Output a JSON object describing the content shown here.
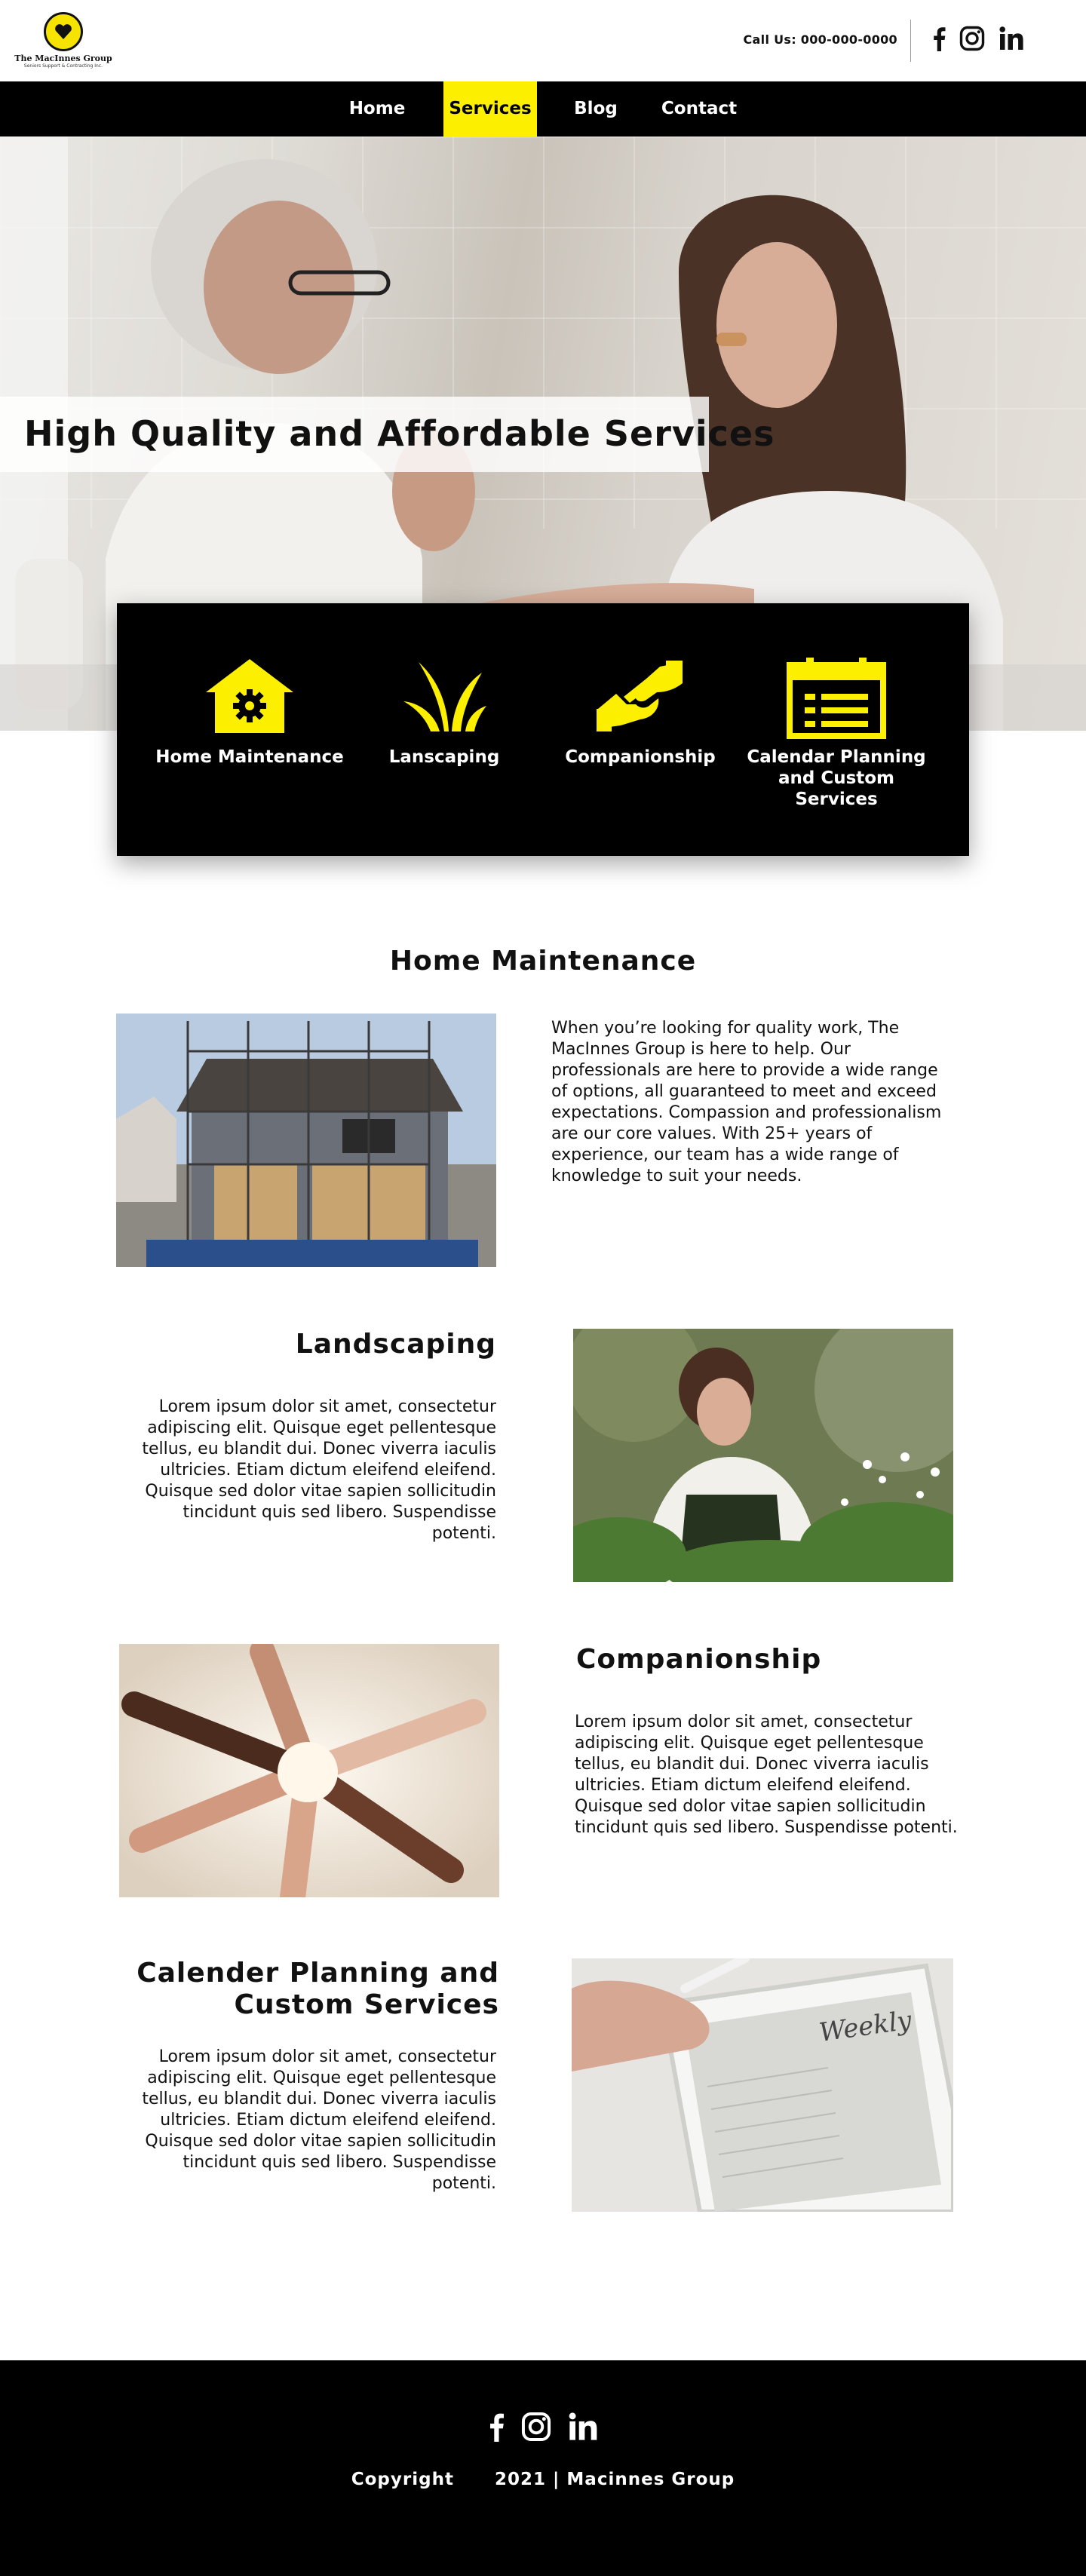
{
  "header": {
    "logo_name": "The MacInnes Group",
    "logo_sub": "Seniors Support & Contracting Inc.",
    "call_label": "Call Us: 000-000-0000",
    "social_icons": [
      "facebook-icon",
      "instagram-icon",
      "linkedin-icon"
    ]
  },
  "nav": {
    "items": [
      {
        "label": "Home",
        "active": false
      },
      {
        "label": "Services",
        "active": true
      },
      {
        "label": "Blog",
        "active": false
      },
      {
        "label": "Contact",
        "active": false
      }
    ]
  },
  "hero": {
    "title": "High Quality and Affordable Services"
  },
  "services_summary": {
    "items": [
      {
        "label": "Home Maintenance",
        "icon": "house-gear-icon"
      },
      {
        "label": "Lanscaping",
        "icon": "plant-icon"
      },
      {
        "label": "Companionship",
        "icon": "handshake-icon"
      },
      {
        "label": "Calendar Planning and Custom Services",
        "icon": "calendar-icon"
      }
    ]
  },
  "sections": {
    "home_maintenance": {
      "title": "Home Maintenance",
      "text": "When you’re looking for quality work, The MacInnes Group is here to help.  Our professionals are here to provide a wide range of options, all guaranteed to meet and exceed expectations. Compassion and professionalism are our core values. With 25+ years of experience, our team has a wide range of knowledge to suit your needs."
    },
    "landscaping": {
      "title": "Landscaping",
      "text": "Lorem ipsum dolor sit amet, consectetur adipiscing elit. Quisque eget pellentesque tellus, eu blandit dui. Donec viverra iaculis ultricies. Etiam dictum eleifend eleifend. Quisque sed dolor vitae sapien sollicitudin tincidunt quis sed libero. Suspendisse potenti."
    },
    "companionship": {
      "title": "Companionship",
      "text": "Lorem ipsum dolor sit amet, consectetur adipiscing elit. Quisque eget pellentesque tellus, eu blandit dui. Donec viverra iaculis ultricies. Etiam dictum eleifend eleifend. Quisque sed dolor vitae sapien sollicitudin tincidunt quis sed libero. Suspendisse potenti."
    },
    "calendar": {
      "title_line1": "Calender Planning and",
      "title_line2": "Custom Services",
      "text": "Lorem ipsum dolor sit amet, consectetur adipiscing elit. Quisque eget pellentesque tellus, eu blandit dui. Donec viverra iaculis ultricies. Etiam dictum eleifend eleifend. Quisque sed dolor vitae sapien sollicitudin tincidunt quis sed libero. Suspendisse potenti."
    }
  },
  "footer": {
    "social_icons": [
      "facebook-icon",
      "instagram-icon",
      "linkedin-icon"
    ],
    "copyright": "Copyright      2021 | Macinnes Group"
  },
  "colors": {
    "accent": "#fcf000",
    "nav_bg": "#000000",
    "footer_bg": "#000000"
  }
}
